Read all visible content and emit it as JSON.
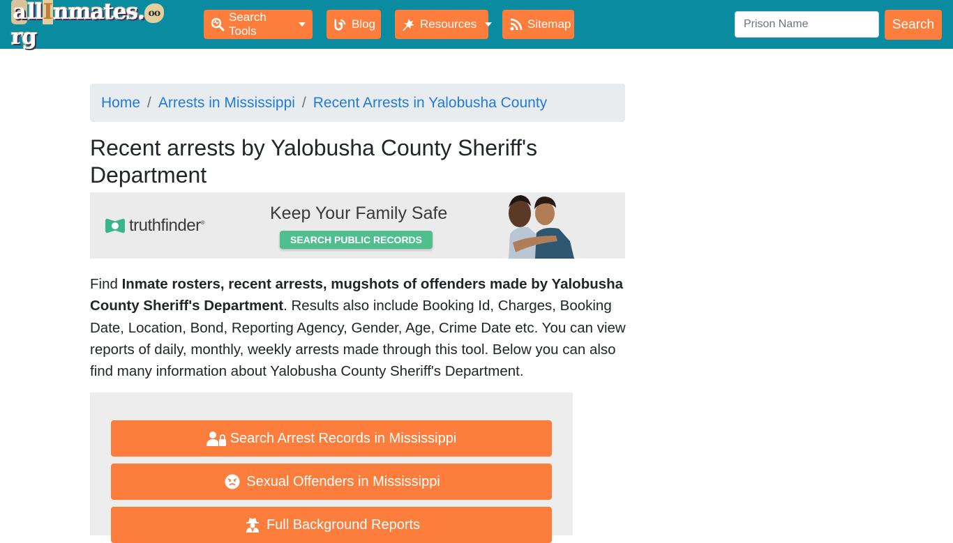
{
  "navbar": {
    "logo": {
      "prefix": "a",
      "ll": "ll",
      "i": "I",
      "rest": "nmates.",
      "o": "oo",
      "suffix": "rg"
    },
    "items": [
      {
        "label": "Search Tools",
        "icon": "search-tools-icon",
        "dropdown": true
      },
      {
        "label": "Blog",
        "icon": "blog-icon",
        "dropdown": false
      },
      {
        "label": "Resources",
        "icon": "leaf-icon",
        "dropdown": true
      },
      {
        "label": "Sitemap",
        "icon": "rss-icon",
        "dropdown": false
      }
    ],
    "search": {
      "placeholder": "Prison Name",
      "value": "",
      "button_label": "Search"
    }
  },
  "breadcrumb": [
    {
      "label": "Home"
    },
    {
      "label": "Arrests in Mississippi"
    },
    {
      "label": "Recent Arrests in Yalobusha County"
    }
  ],
  "breadcrumb_separator": "/",
  "page_title": "Recent arrests by Yalobusha County Sheriff's Department",
  "ad": {
    "brand": "truthfinder",
    "registered": "®",
    "headline": "Keep Your Family Safe",
    "cta": "SEARCH PUBLIC RECORDS"
  },
  "description": {
    "lead": "Find ",
    "bold": "Inmate rosters, recent arrests, mugshots of offenders made by Yalobusha County Sheriff's Department",
    "rest": ". Results also include Booking Id, Charges, Booking Date, Location, Bond, Reporting Agency, Gender, Age, Crime Date etc. You can view reports of daily, monthly, weekly arrests made through this tool. Below you can also find many information about Yalobusha County Sheriff's Department."
  },
  "actions": [
    {
      "label": "Search Arrest Records in Mississippi",
      "icon": "user-lock-icon"
    },
    {
      "label": "Sexual Offenders in Mississippi",
      "icon": "angry-face-icon"
    },
    {
      "label": "Full Background Reports",
      "icon": "user-secret-icon"
    }
  ],
  "colors": {
    "navbar_bg": "#0a8ba0",
    "accent_orange": "#fd7e3c",
    "link_blue": "#1e7bd9",
    "breadcrumb_bg": "#e9ecef",
    "panel_bg": "#ededed",
    "ad_cta_green": "#4fc08d"
  }
}
